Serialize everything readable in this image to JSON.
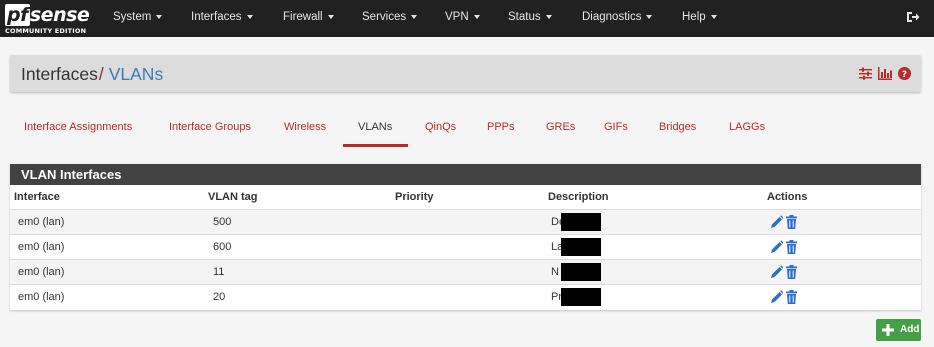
{
  "brand": {
    "name_prefix": "pf",
    "name_suffix": "sense",
    "edition": "COMMUNITY EDITION"
  },
  "nav": {
    "items": [
      {
        "label": "System",
        "name": "nav-system"
      },
      {
        "label": "Interfaces",
        "name": "nav-interfaces"
      },
      {
        "label": "Firewall",
        "name": "nav-firewall"
      },
      {
        "label": "Services",
        "name": "nav-services"
      },
      {
        "label": "VPN",
        "name": "nav-vpn"
      },
      {
        "label": "Status",
        "name": "nav-status"
      },
      {
        "label": "Diagnostics",
        "name": "nav-diagnostics"
      },
      {
        "label": "Help",
        "name": "nav-help"
      }
    ],
    "logout_icon": "sign-out-icon"
  },
  "breadcrumb": {
    "parent": "Interfaces",
    "separator": "/",
    "current": "VLANs"
  },
  "header_icons": [
    "sliders-icon",
    "bar-chart-icon",
    "question-circle-icon"
  ],
  "tabs": [
    {
      "label": "Interface Assignments",
      "active": false
    },
    {
      "label": "Interface Groups",
      "active": false
    },
    {
      "label": "Wireless",
      "active": false
    },
    {
      "label": "VLANs",
      "active": true
    },
    {
      "label": "QinQs",
      "active": false
    },
    {
      "label": "PPPs",
      "active": false
    },
    {
      "label": "GREs",
      "active": false
    },
    {
      "label": "GIFs",
      "active": false
    },
    {
      "label": "Bridges",
      "active": false
    },
    {
      "label": "LAGGs",
      "active": false
    }
  ],
  "panel": {
    "title": "VLAN Interfaces",
    "columns": [
      "Interface",
      "VLAN tag",
      "Priority",
      "Description",
      "Actions"
    ],
    "rows": [
      {
        "interface": "em0 (lan)",
        "vlan_tag": "500",
        "priority": "",
        "description_visible": "De"
      },
      {
        "interface": "em0 (lan)",
        "vlan_tag": "600",
        "priority": "",
        "description_visible": "La"
      },
      {
        "interface": "em0 (lan)",
        "vlan_tag": "11",
        "priority": "",
        "description_visible": "N"
      },
      {
        "interface": "em0 (lan)",
        "vlan_tag": "20",
        "priority": "",
        "description_visible": "Pr"
      }
    ],
    "row_actions": [
      "pencil-icon",
      "trash-icon"
    ]
  },
  "add_button": {
    "label": "Add",
    "icon": "plus-icon"
  },
  "colors": {
    "navbar": "#212121",
    "accent_red": "#b92b2b",
    "link_blue": "#3e7ab8",
    "action_blue": "#2a6fc9",
    "add_green": "#43a047"
  }
}
